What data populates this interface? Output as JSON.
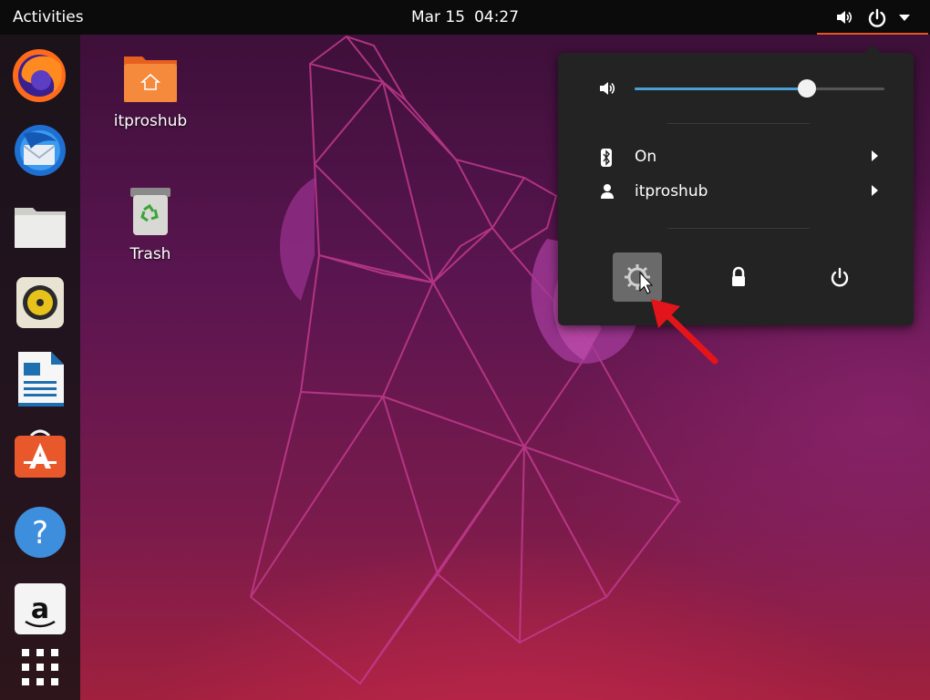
{
  "topbar": {
    "activities_label": "Activities",
    "clock": {
      "date": "Mar 15",
      "time": "04:27"
    },
    "tray_icons": [
      "volume-icon",
      "power-icon",
      "dropdown-arrow-icon"
    ]
  },
  "dock": {
    "apps": [
      "Firefox",
      "Thunderbird",
      "Files",
      "Rhythmbox",
      "LibreOffice Writer",
      "Ubuntu Software",
      "Help",
      "Amazon",
      "Show Applications"
    ]
  },
  "desktop": {
    "icons": [
      {
        "label": "itproshub",
        "icon": "home-folder-icon"
      },
      {
        "label": "Trash",
        "icon": "trash-icon"
      }
    ]
  },
  "system_menu": {
    "volume_level": 0.69,
    "bluetooth": {
      "label": "On",
      "icon": "bluetooth-icon"
    },
    "user": {
      "label": "itproshub",
      "icon": "user-icon"
    },
    "actions": [
      "settings-icon",
      "lock-icon",
      "power-icon"
    ],
    "hovered_action": "settings-icon"
  },
  "colors": {
    "accent": "#e95420",
    "slider": "#48a0d4",
    "menu_bg": "#232323",
    "annotation_arrow": "#e3151a"
  }
}
